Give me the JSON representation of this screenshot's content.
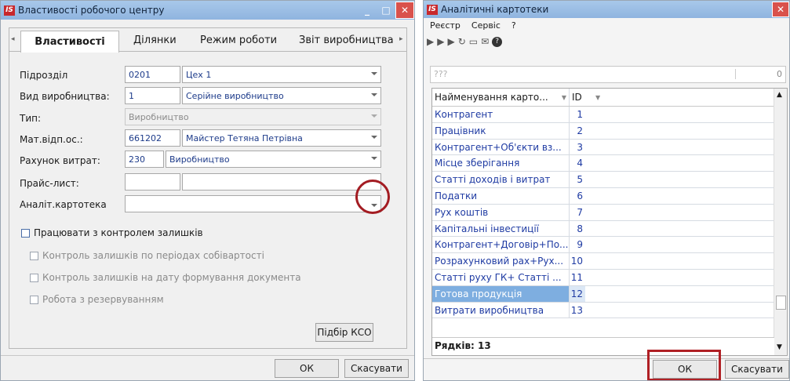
{
  "left_window": {
    "title": "Властивості робочого центру",
    "tabs": [
      "Властивості",
      "Ділянки",
      "Режим роботи",
      "Звіт виробництва"
    ],
    "fields": {
      "pidrozdil": {
        "label": "Підрозділ",
        "code": "0201",
        "name": "Цех 1"
      },
      "vyd": {
        "label": "Вид виробництва:",
        "code": "1",
        "name": "Серійне виробництво"
      },
      "typ": {
        "label": "Тип:",
        "name": "Виробництво"
      },
      "mat": {
        "label": "Мат.відп.ос.:",
        "code": "661202",
        "name": "Майстер Тетяна Петрівна"
      },
      "rah": {
        "label": "Рахунок витрат:",
        "code": "230",
        "name": "Виробництво"
      },
      "price": {
        "label": "Прайс-лист:"
      },
      "anal": {
        "label": "Аналіт.картотека"
      }
    },
    "checkbox_main": "Працювати з контролем залишків",
    "checkbox_sub": [
      "Контроль залишків по періодах собівартості",
      "Контроль залишків на дату формування документа",
      "Робота з резервуванням"
    ],
    "pidbir_btn": "Підбір КСО",
    "ok_btn": "ОК",
    "cancel_btn": "Скасувати"
  },
  "right_window": {
    "title": "Аналітичні картотеки",
    "menu": [
      "Реєстр",
      "Сервіс",
      "?"
    ],
    "search_placeholder": "???",
    "search_value": "0",
    "col_name": "Найменування карто...",
    "col_id": "ID",
    "rows": [
      {
        "name": "Контрагент",
        "id": "1"
      },
      {
        "name": "Працівник",
        "id": "2"
      },
      {
        "name": "Контрагент+Об'єкти вз...",
        "id": "3"
      },
      {
        "name": "Місце зберігання",
        "id": "4"
      },
      {
        "name": "Статті доходів і витрат",
        "id": "5"
      },
      {
        "name": "Податки",
        "id": "6"
      },
      {
        "name": "Рух коштів",
        "id": "7"
      },
      {
        "name": "Капітальні інвестиції",
        "id": "8"
      },
      {
        "name": "Контрагент+Договір+По...",
        "id": "9"
      },
      {
        "name": "Розрахунковий рах+Рух...",
        "id": "10"
      },
      {
        "name": "Статті руху ГК+ Статті ...",
        "id": "11"
      },
      {
        "name": "Готова продукція",
        "id": "12"
      },
      {
        "name": "Витрати виробництва",
        "id": "13"
      }
    ],
    "rows_count_label": "Рядків: 13",
    "ok_btn": "ОК",
    "cancel_btn": "Скасувати"
  },
  "colors": {
    "highlight_box": "#b02025",
    "circle": "#a31c22",
    "selected_row": "#7eaee0"
  }
}
